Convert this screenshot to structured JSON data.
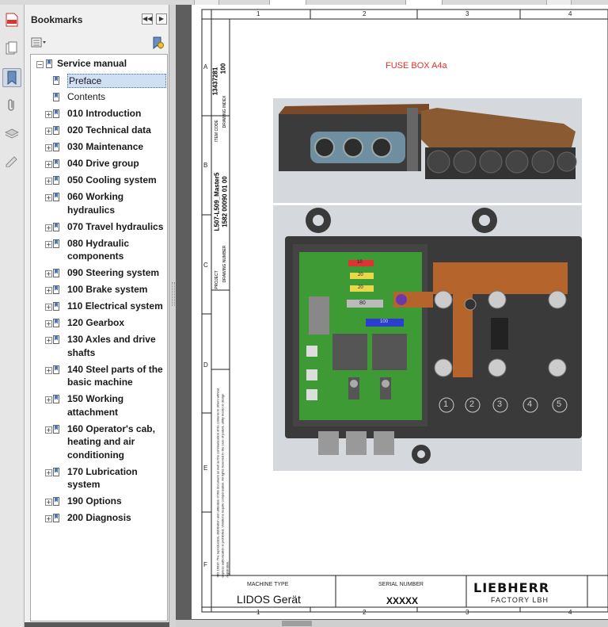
{
  "panel": {
    "title": "Bookmarks"
  },
  "bookmarks": [
    {
      "label": "Service manual",
      "level": 0,
      "bold": true,
      "expander": "−"
    },
    {
      "label": "Preface",
      "level": 1,
      "bold": false,
      "selected": true
    },
    {
      "label": "Contents",
      "level": 1,
      "bold": false
    },
    {
      "label": "010 Introduction",
      "level": 1,
      "bold": true,
      "expander": "+"
    },
    {
      "label": "020 Technical data",
      "level": 1,
      "bold": true,
      "expander": "+"
    },
    {
      "label": "030 Maintenance",
      "level": 1,
      "bold": true,
      "expander": "+"
    },
    {
      "label": "040 Drive group",
      "level": 1,
      "bold": true,
      "expander": "+"
    },
    {
      "label": "050 Cooling system",
      "level": 1,
      "bold": true,
      "expander": "+"
    },
    {
      "label": "060 Working",
      "label2": "hydraulics",
      "level": 1,
      "bold": true,
      "expander": "+"
    },
    {
      "label": "070 Travel hydraulics",
      "level": 1,
      "bold": true,
      "expander": "+"
    },
    {
      "label": "080 Hydraulic",
      "label2": "components",
      "level": 1,
      "bold": true,
      "expander": "+"
    },
    {
      "label": "090 Steering system",
      "level": 1,
      "bold": true,
      "expander": "+"
    },
    {
      "label": "100 Brake system",
      "level": 1,
      "bold": true,
      "expander": "+"
    },
    {
      "label": "110 Electrical system",
      "level": 1,
      "bold": true,
      "expander": "+"
    },
    {
      "label": "120 Gearbox",
      "level": 1,
      "bold": true,
      "expander": "+"
    },
    {
      "label": "130 Axles and drive",
      "label2": "shafts",
      "level": 1,
      "bold": true,
      "expander": "+"
    },
    {
      "label": "140 Steel parts of the",
      "label2": "basic machine",
      "level": 1,
      "bold": true,
      "expander": "+"
    },
    {
      "label": "150 Working",
      "label2": "attachment",
      "level": 1,
      "bold": true,
      "expander": "+"
    },
    {
      "label": "160 Operator's cab,",
      "label2": "heating and air",
      "label3": "conditioning",
      "level": 1,
      "bold": true,
      "expander": "+"
    },
    {
      "label": "170 Lubrication",
      "label2": "system",
      "level": 1,
      "bold": true,
      "expander": "+"
    },
    {
      "label": "190 Options",
      "level": 1,
      "bold": true,
      "expander": "+"
    },
    {
      "label": "200 Diagnosis",
      "level": 1,
      "bold": true,
      "expander": "+"
    }
  ],
  "drawing": {
    "title": "FUSE BOX A4a",
    "col_numbers": [
      "1",
      "2",
      "3",
      "4"
    ],
    "row_letters": [
      "A",
      "B",
      "C",
      "D",
      "E",
      "F"
    ],
    "side_labels": {
      "item_code_label": "ITEM CODE",
      "item_code": "13437281",
      "drawing_index_label": "DRAWING INDEX",
      "drawing_index": "100",
      "project_label": "PROJECT",
      "project": "L507-L509_Master5",
      "drawing_number_label": "DRAWING NUMBER",
      "drawing_number": "1582 00090 01 00",
      "legal_1": "ISO 16016: The reproduction, distribution and utilization of this document as well as the communication of its contents to others without",
      "legal_2": "express authorization is prohibited. Violations require compensation. All rights reserved in the case of patent, utility model or design",
      "legal_3": "registration."
    },
    "title_block": {
      "machine_type_label": "MACHINE TYPE",
      "machine_type": "LIDOS Gerät",
      "serial_number_label": "SERIAL NUMBER",
      "serial_number": "XXXXX",
      "brand": "LIEBHERR",
      "factory": "FACTORY LBH"
    },
    "fuse_labels": {
      "f1": "10",
      "f2": "20",
      "f3": "20",
      "f4": "80",
      "f5": "100"
    },
    "terminal_numbers": [
      "1",
      "2",
      "3",
      "4",
      "5"
    ]
  },
  "colors": {
    "title_red": "#e0302a",
    "copper": "#b5652c",
    "pcb_green": "#3e9a34",
    "housing": "#3a3a3a"
  }
}
